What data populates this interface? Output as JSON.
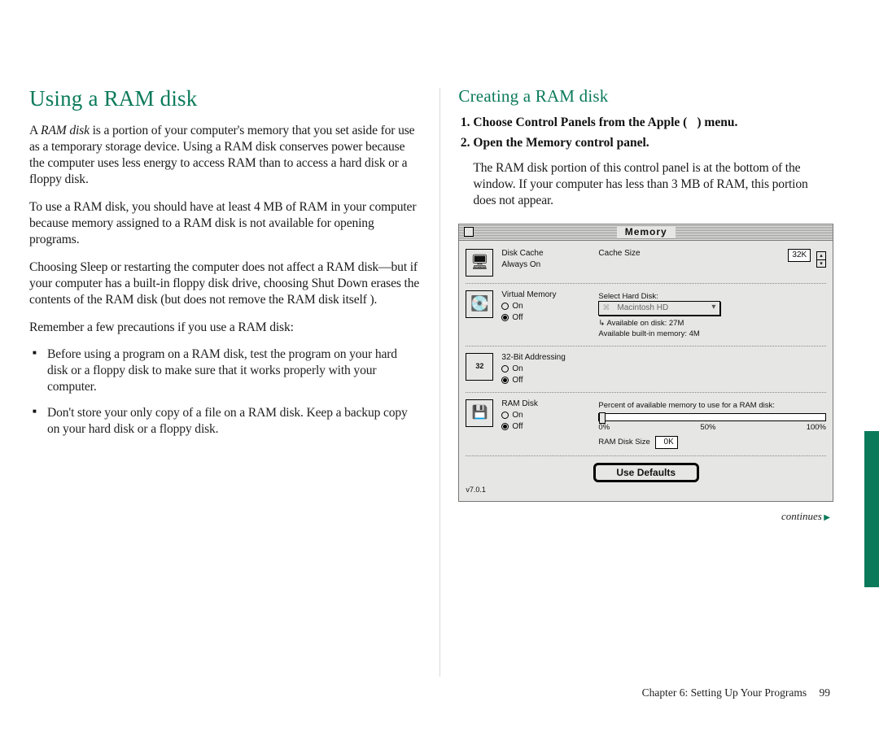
{
  "left": {
    "heading": "Using a RAM disk",
    "p1_a": "A ",
    "p1_b": "RAM disk",
    "p1_c": " is a portion of your computer's memory that you set aside for use as a temporary storage device. Using a RAM disk conserves power because the computer uses less energy to access RAM than to access a hard disk or a floppy disk.",
    "p2": "To use a RAM disk, you should have at least 4 MB of RAM in your computer because memory assigned to a RAM disk is not available for opening programs.",
    "p3": "Choosing Sleep or restarting the computer does not affect a RAM disk—but if your computer has a built-in floppy disk drive, choosing Shut Down erases the contents of the RAM disk (but does not remove the RAM disk itself ).",
    "p4": "Remember a few precautions if you use a RAM disk:",
    "b1": "Before using a program on a RAM disk, test the program on your hard disk or a floppy disk to make sure that it works properly with your computer.",
    "b2": "Don't store your only copy of a file on a RAM disk. Keep a backup copy on your hard disk or a floppy disk."
  },
  "right": {
    "heading": "Creating a RAM disk",
    "step1": "Choose Control Panels from the Apple () menu.",
    "step2": "Open the Memory control panel.",
    "p1": "The RAM disk portion of this control panel is at the bottom of the window. If your computer has less than 3 MB of RAM, this portion does not appear.",
    "continues": "continues"
  },
  "panel": {
    "title": "Memory",
    "diskCacheLabel": "Disk Cache",
    "alwaysOn": "Always On",
    "cacheSizeLabel": "Cache Size",
    "cacheSizeValue": "32K",
    "vmLabel": "Virtual Memory",
    "on": "On",
    "off": "Off",
    "selectHardDisk": "Select Hard Disk:",
    "hdName": "Macintosh HD",
    "availDisk": "Available on disk: 27M",
    "availMem": "Available built-in memory: 4M",
    "addr32Label": "32-Bit Addressing",
    "ramDiskLabel": "RAM Disk",
    "percentLabel": "Percent of available memory to use for a RAM disk:",
    "tick0": "0%",
    "tick50": "50%",
    "tick100": "100%",
    "ramDiskSizeLabel": "RAM Disk Size",
    "ramDiskSizeValue": "0K",
    "useDefaults": "Use Defaults",
    "version": "v7.0.1",
    "chipLabel": "32"
  },
  "footer": {
    "chapter": "Chapter 6: Setting Up Your Programs",
    "page": "99"
  }
}
